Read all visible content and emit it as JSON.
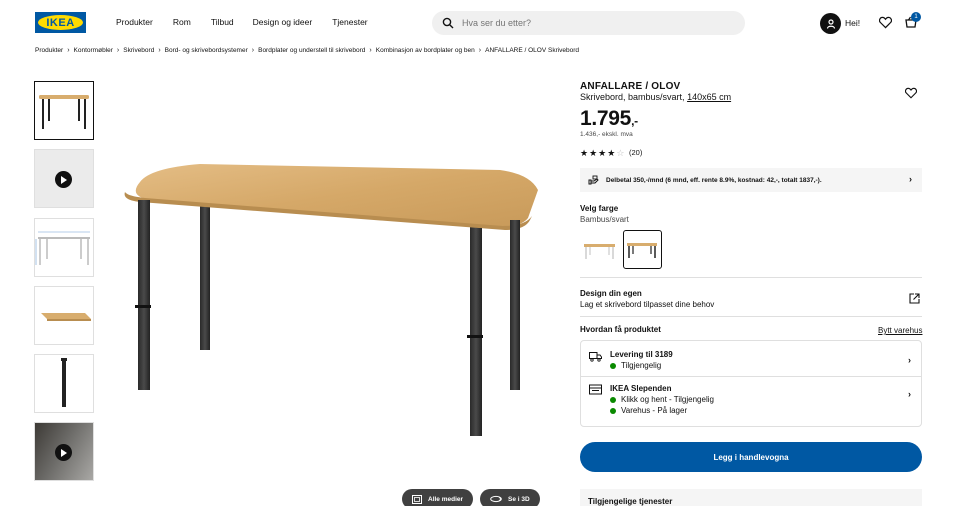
{
  "header": {
    "logo_text": "IKEA",
    "nav": [
      "Produkter",
      "Rom",
      "Tilbud",
      "Design og ideer",
      "Tjenester"
    ],
    "search_placeholder": "Hva ser du etter?",
    "greeting": "Hei!",
    "cart_count": "1"
  },
  "breadcrumbs": [
    "Produkter",
    "Kontormøbler",
    "Skrivebord",
    "Bord- og skrivebordsystemer",
    "Bordplater og understell til skrivebord",
    "Kombinasjon av bordplater og ben",
    "ANFALLARE / OLOV Skrivebord"
  ],
  "gallery": {
    "buttons": [
      "Alle medier",
      "Se i 3D"
    ]
  },
  "product": {
    "name": "ANFALLARE / OLOV",
    "description": "Skrivebord, bambus/svart,",
    "size": "140x65 cm",
    "price": "1.795",
    "price_suffix": ",-",
    "price_ex_vat": "1.436,- ekskl. mva",
    "rating": 3.5,
    "rating_count": "(20)",
    "finance_text": "Delbetal 350,-/mnd (6 mnd, eff. rente 8.9%, kostnad: 42,-, totalt 1837,-).",
    "color_title": "Velg farge",
    "color_name": "Bambus/svart",
    "design_title": "Design din egen",
    "design_subtitle": "Lag et skrivebord tilpasset dine behov",
    "how_title": "Hvordan få produktet",
    "change_store": "Bytt varehus",
    "delivery": {
      "title": "Levering til 3189",
      "status": "Tilgjengelig"
    },
    "store": {
      "title": "IKEA Slependen",
      "click_collect": "Klikk og hent - Tilgjengelig",
      "in_store": "Varehus - På lager"
    },
    "add_to_cart": "Legg i handlevogna",
    "services_title": "Tilgjengelige tjenester"
  },
  "colors": {
    "brand_blue": "#0058a3",
    "brand_yellow": "#ffdb00",
    "available_green": "#0a8a00"
  }
}
